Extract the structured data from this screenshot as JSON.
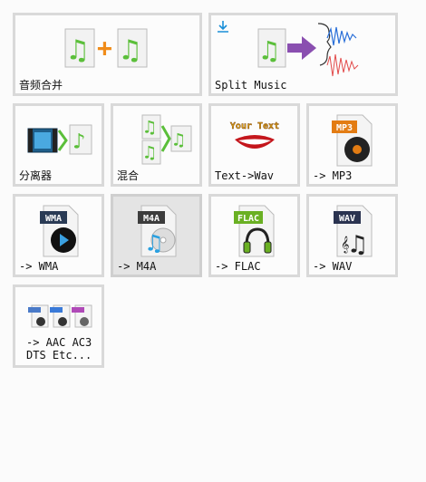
{
  "tiles": [
    {
      "label": "音频合并"
    },
    {
      "label": "Split Music"
    },
    {
      "label": "分离器"
    },
    {
      "label": "混合"
    },
    {
      "label": "Text->Wav",
      "icon_text": "Your Text"
    },
    {
      "label": "-> MP3",
      "badge": "MP3"
    },
    {
      "label": "-> WMA",
      "badge": "WMA"
    },
    {
      "label": "-> M4A",
      "badge": "M4A",
      "selected": true
    },
    {
      "label": "-> FLAC",
      "badge": "FLAC"
    },
    {
      "label": "-> WAV",
      "badge": "WAV"
    },
    {
      "label": "-> AAC AC3\nDTS Etc..."
    }
  ],
  "colors": {
    "mp3": "#e37c13",
    "wma": "#2a3b55",
    "m4a": "#3c3c3c",
    "flac": "#6ab023",
    "wav": "#2a3350",
    "note_green": "#5bbf3a"
  }
}
